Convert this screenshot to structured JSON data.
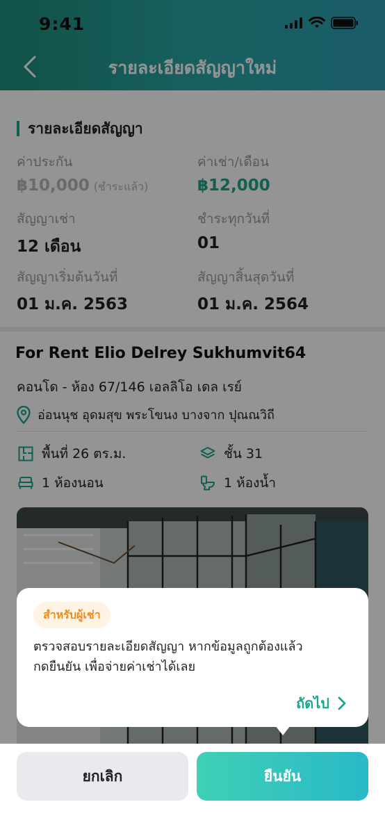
{
  "status_bar": {
    "time": "9:41"
  },
  "header": {
    "title": "รายละเอียดสัญญาใหม่"
  },
  "contract": {
    "section_title": "รายละเอียดสัญญา",
    "deposit_label": "ค่าประกัน",
    "deposit_value": "฿10,000",
    "deposit_note": "(ชำระแล้ว)",
    "rent_label": "ค่าเช่า/เดือน",
    "rent_value": "฿12,000",
    "term_label": "สัญญาเช่า",
    "term_value": "12 เดือน",
    "payday_label": "ชำระทุกวันที่",
    "payday_value": "01",
    "start_label": "สัญญาเริ่มต้นวันที่",
    "start_value": "01 ม.ค. 2563",
    "end_label": "สัญญาสิ้นสุดวันที่",
    "end_value": "01 ม.ค. 2564"
  },
  "property": {
    "title": "For Rent Elio Delrey Sukhumvit64",
    "type_line": "คอนโด - ห้อง 67/146 เอลลิโอ เดล เรย์",
    "location": "อ่อนนุช อุดมสุข พระโขนง บางจาก ปุณณวิถี",
    "area": "พื้นที่ 26 ตร.ม.",
    "floor": "ชั้น 31",
    "bedrooms": "1 ห้องนอน",
    "bathrooms": "1 ห้องน้ำ"
  },
  "tooltip": {
    "badge": "สำหรับผู้เช่า",
    "line1": "ตรวจสอบรายละเอียดสัญญา หากข้อมูลถูกต้องแล้ว",
    "line2": "กดยืนยัน เพื่อจ่ายค่าเช่าได้เลย",
    "next_label": "ถัดไป"
  },
  "actions": {
    "cancel_label": "ยกเลิก",
    "confirm_label": "ยืนยัน"
  },
  "colors": {
    "accent": "#1aa58e",
    "badge_text": "#f28b1a",
    "badge_bg": "#fff3e4",
    "header_start": "#1e8f7e",
    "header_end": "#2f9fb6"
  }
}
